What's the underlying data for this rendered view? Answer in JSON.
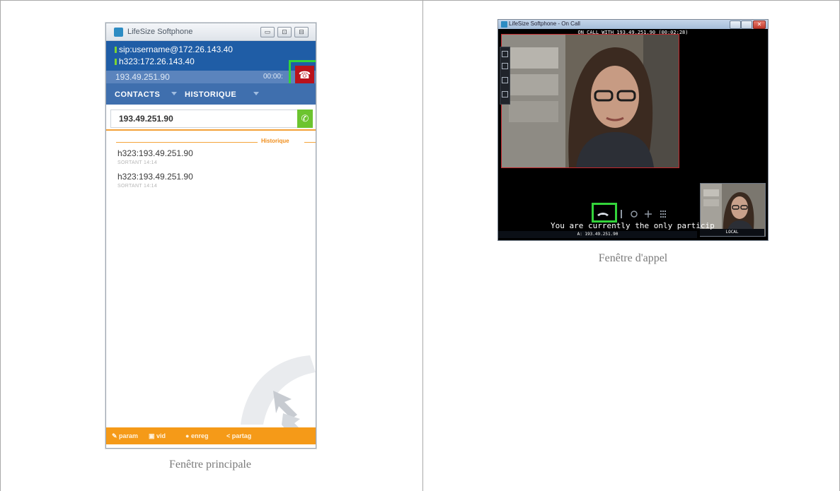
{
  "main_window": {
    "title": "LifeSize Softphone",
    "window_buttons": [
      "▭",
      "⊡",
      "⊟"
    ],
    "status_sip": "sip:username@172.26.143.40",
    "status_h323": "h323:172.26.143.40",
    "call_ip": "193.49.251.90",
    "call_timer": "00:00:",
    "tabs": {
      "contacts": "CONTACTS",
      "historique": "HISTORIQUE"
    },
    "dial_value": "193.49.251.90",
    "history_label": "Historique",
    "history_items": [
      {
        "name": "h323:193.49.251.90",
        "sub": "SORTANT 14:14"
      },
      {
        "name": "h323:193.49.251.90",
        "sub": "SORTANT 14:14"
      }
    ],
    "footer": {
      "param": "param",
      "vid": "vid",
      "enreg": "enreg",
      "partag": "partag"
    },
    "hangup_icon": "phone-hangup-icon",
    "call_icon": "phone-icon"
  },
  "call_window": {
    "title": "LifeSize Softphone - On Call",
    "on_call": "ON CALL WITH 193.49.251.90 (00:02:28)",
    "message": "You are currently the only particip",
    "address": "A: 193.49.251.90",
    "local_label": "LOCAL"
  },
  "captions": {
    "main": "Fenêtre principale",
    "call": "Fenêtre d'appel"
  },
  "colors": {
    "highlight": "#33d43a",
    "hangup": "#b9121b",
    "accent_orange": "#f59a18",
    "status_blue": "#1f5da6"
  }
}
